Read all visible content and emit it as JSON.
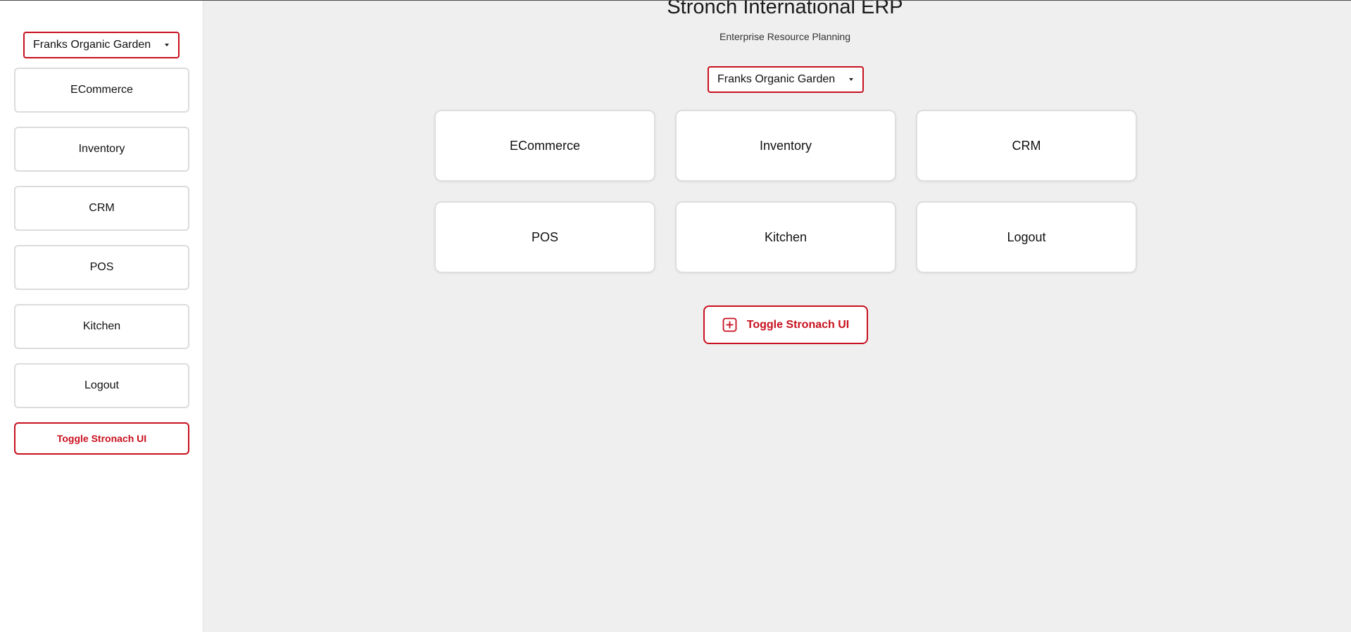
{
  "sidebar": {
    "company_select": {
      "selected": "Franks Organic Garden"
    },
    "items": [
      {
        "label": "ECommerce"
      },
      {
        "label": "Inventory"
      },
      {
        "label": "CRM"
      },
      {
        "label": "POS"
      },
      {
        "label": "Kitchen"
      },
      {
        "label": "Logout"
      }
    ],
    "toggle_label": "Toggle Stronach UI"
  },
  "main": {
    "title": "Stronch International ERP",
    "subtitle": "Enterprise Resource Planning",
    "company_select": {
      "selected": "Franks Organic Garden"
    },
    "cards": [
      {
        "label": "ECommerce"
      },
      {
        "label": "Inventory"
      },
      {
        "label": "CRM"
      },
      {
        "label": "POS"
      },
      {
        "label": "Kitchen"
      },
      {
        "label": "Logout"
      }
    ],
    "toggle_label": "Toggle Stronach UI",
    "toggle_icon": "plus-square-icon"
  },
  "colors": {
    "accent": "#c8101e",
    "background": "#efefef",
    "surface": "#ffffff",
    "border": "#dcdcdc"
  }
}
